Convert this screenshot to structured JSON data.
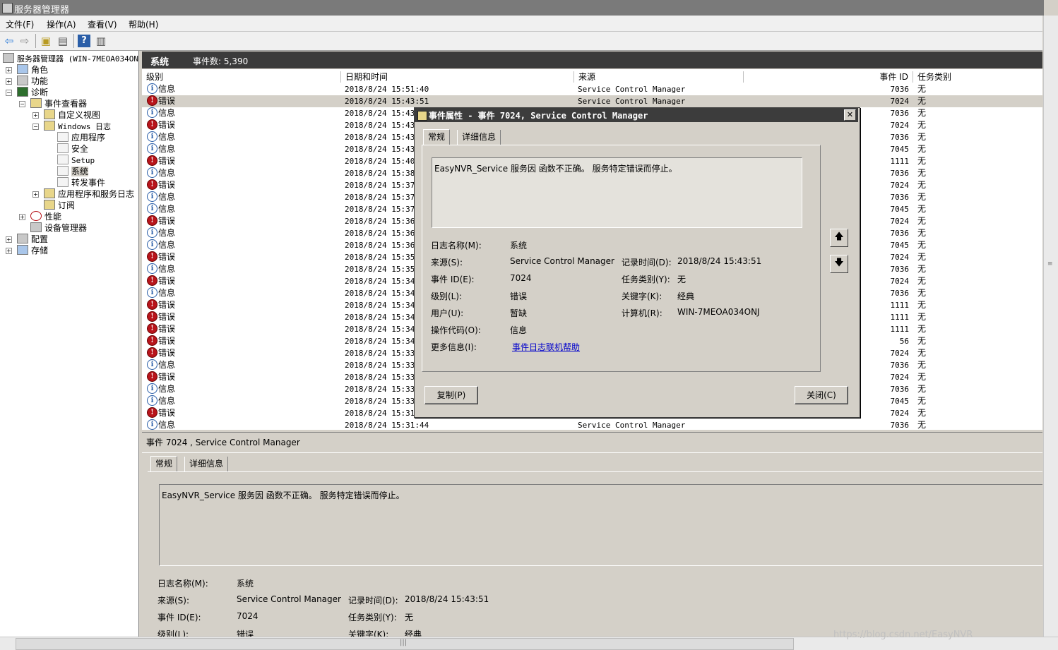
{
  "window": {
    "title": "服务器管理器"
  },
  "menu": [
    "文件(F)",
    "操作(A)",
    "查看(V)",
    "帮助(H)"
  ],
  "tree": {
    "root": "服务器管理器 (WIN-7MEOA034ON",
    "items": [
      "角色",
      "功能",
      "诊断",
      "事件查看器",
      "自定义视图",
      "Windows 日志",
      "应用程序",
      "安全",
      "Setup",
      "系统",
      "转发事件",
      "应用程序和服务日志",
      "订阅",
      "性能",
      "设备管理器",
      "配置",
      "存储"
    ],
    "selected": "系统"
  },
  "pane": {
    "title": "系统",
    "count_label": "事件数: 5,390"
  },
  "list": {
    "columns": [
      "级别",
      "日期和时间",
      "来源",
      "事件 ID",
      "任务类别"
    ],
    "rows": [
      {
        "level": "信息",
        "type": "info",
        "datetime": "2018/8/24 15:51:40",
        "source": "Service Control Manager",
        "id": "7036",
        "task": "无"
      },
      {
        "level": "错误",
        "type": "err",
        "datetime": "2018/8/24 15:43:51",
        "source": "Service Control Manager",
        "id": "7024",
        "task": "无"
      },
      {
        "level": "信息",
        "type": "info",
        "datetime": "2018/8/24 15:43:",
        "source": "",
        "id": "7036",
        "task": "无"
      },
      {
        "level": "错误",
        "type": "err",
        "datetime": "2018/8/24 15:43:",
        "source": "",
        "id": "7024",
        "task": "无"
      },
      {
        "level": "信息",
        "type": "info",
        "datetime": "2018/8/24 15:43:",
        "source": "",
        "id": "7036",
        "task": "无"
      },
      {
        "level": "信息",
        "type": "info",
        "datetime": "2018/8/24 15:43:",
        "source": "",
        "id": "7045",
        "task": "无"
      },
      {
        "level": "错误",
        "type": "err",
        "datetime": "2018/8/24 15:40:",
        "source": "",
        "id": "1111",
        "task": "无"
      },
      {
        "level": "信息",
        "type": "info",
        "datetime": "2018/8/24 15:38:",
        "source": "",
        "id": "7036",
        "task": "无"
      },
      {
        "level": "错误",
        "type": "err",
        "datetime": "2018/8/24 15:37:",
        "source": "",
        "id": "7024",
        "task": "无"
      },
      {
        "level": "信息",
        "type": "info",
        "datetime": "2018/8/24 15:37:",
        "source": "",
        "id": "7036",
        "task": "无"
      },
      {
        "level": "信息",
        "type": "info",
        "datetime": "2018/8/24 15:37:",
        "source": "",
        "id": "7045",
        "task": "无"
      },
      {
        "level": "错误",
        "type": "err",
        "datetime": "2018/8/24 15:36:",
        "source": "",
        "id": "7024",
        "task": "无"
      },
      {
        "level": "信息",
        "type": "info",
        "datetime": "2018/8/24 15:36:",
        "source": "",
        "id": "7036",
        "task": "无"
      },
      {
        "level": "信息",
        "type": "info",
        "datetime": "2018/8/24 15:36:",
        "source": "",
        "id": "7045",
        "task": "无"
      },
      {
        "level": "错误",
        "type": "err",
        "datetime": "2018/8/24 15:35:",
        "source": "",
        "id": "7024",
        "task": "无"
      },
      {
        "level": "信息",
        "type": "info",
        "datetime": "2018/8/24 15:35:",
        "source": "",
        "id": "7036",
        "task": "无"
      },
      {
        "level": "错误",
        "type": "err",
        "datetime": "2018/8/24 15:34:",
        "source": "",
        "id": "7024",
        "task": "无"
      },
      {
        "level": "信息",
        "type": "info",
        "datetime": "2018/8/24 15:34:",
        "source": "",
        "id": "7036",
        "task": "无"
      },
      {
        "level": "错误",
        "type": "err",
        "datetime": "2018/8/24 15:34:",
        "source": "",
        "id": "1111",
        "task": "无"
      },
      {
        "level": "错误",
        "type": "err",
        "datetime": "2018/8/24 15:34:",
        "source": "",
        "id": "1111",
        "task": "无"
      },
      {
        "level": "错误",
        "type": "err",
        "datetime": "2018/8/24 15:34:",
        "source": "",
        "id": "1111",
        "task": "无"
      },
      {
        "level": "错误",
        "type": "err",
        "datetime": "2018/8/24 15:34:",
        "source": "",
        "id": "56",
        "task": "无"
      },
      {
        "level": "错误",
        "type": "err",
        "datetime": "2018/8/24 15:33:",
        "source": "",
        "id": "7024",
        "task": "无"
      },
      {
        "level": "信息",
        "type": "info",
        "datetime": "2018/8/24 15:33:",
        "source": "",
        "id": "7036",
        "task": "无"
      },
      {
        "level": "错误",
        "type": "err",
        "datetime": "2018/8/24 15:33:",
        "source": "",
        "id": "7024",
        "task": "无"
      },
      {
        "level": "信息",
        "type": "info",
        "datetime": "2018/8/24 15:33:",
        "source": "",
        "id": "7036",
        "task": "无"
      },
      {
        "level": "信息",
        "type": "info",
        "datetime": "2018/8/24 15:33:",
        "source": "",
        "id": "7045",
        "task": "无"
      },
      {
        "level": "错误",
        "type": "err",
        "datetime": "2018/8/24 15:31:",
        "source": "",
        "id": "7024",
        "task": "无"
      },
      {
        "level": "信息",
        "type": "info",
        "datetime": "2018/8/24 15:31:44",
        "source": "Service Control Manager",
        "id": "7036",
        "task": "无"
      }
    ]
  },
  "preview": {
    "header": "事件 7024 , Service Control Manager",
    "tabs": [
      "常规",
      "详细信息"
    ],
    "message": "EasyNVR_Service 服务因 函数不正确。 服务特定错误而停止。",
    "labels": {
      "log": "日志名称(M):",
      "source": "来源(S):",
      "id": "事件 ID(E):",
      "level": "级别(L):",
      "recorded": "记录时间(D):",
      "task": "任务类别(Y):",
      "keyword": "关键字(K):"
    },
    "values": {
      "log": "系统",
      "source": "Service Control Manager",
      "id": "7024",
      "level": "错误",
      "recorded": "2018/8/24 15:43:51",
      "task": "无",
      "keyword": "经典"
    }
  },
  "dialog": {
    "title": "事件属性 - 事件 7024, Service Control Manager",
    "tabs": [
      "常规",
      "详细信息"
    ],
    "message": "EasyNVR_Service 服务因 函数不正确。 服务特定错误而停止。",
    "labels": {
      "log": "日志名称(M):",
      "source": "来源(S):",
      "id": "事件 ID(E):",
      "level": "级别(L):",
      "user": "用户(U):",
      "opcode": "操作代码(O):",
      "more": "更多信息(I):",
      "recorded": "记录时间(D):",
      "task": "任务类别(Y):",
      "keyword": "关键字(K):",
      "computer": "计算机(R):"
    },
    "values": {
      "log": "系统",
      "source": "Service Control Manager",
      "id": "7024",
      "level": "错误",
      "user": "暂缺",
      "opcode": "信息",
      "more_link": "事件日志联机帮助",
      "recorded": "2018/8/24 15:43:51",
      "task": "无",
      "keyword": "经典",
      "computer": "WIN-7MEOA034ONJ"
    },
    "copy_button": "复制(P)",
    "close_button": "关闭(C)"
  },
  "watermark": "https://blog.csdn.net/EasyNVR",
  "colors": {
    "error": "#b8141b",
    "info": "#2a5ea8",
    "link": "#0000cc",
    "header_bar": "#3b3b3b"
  }
}
